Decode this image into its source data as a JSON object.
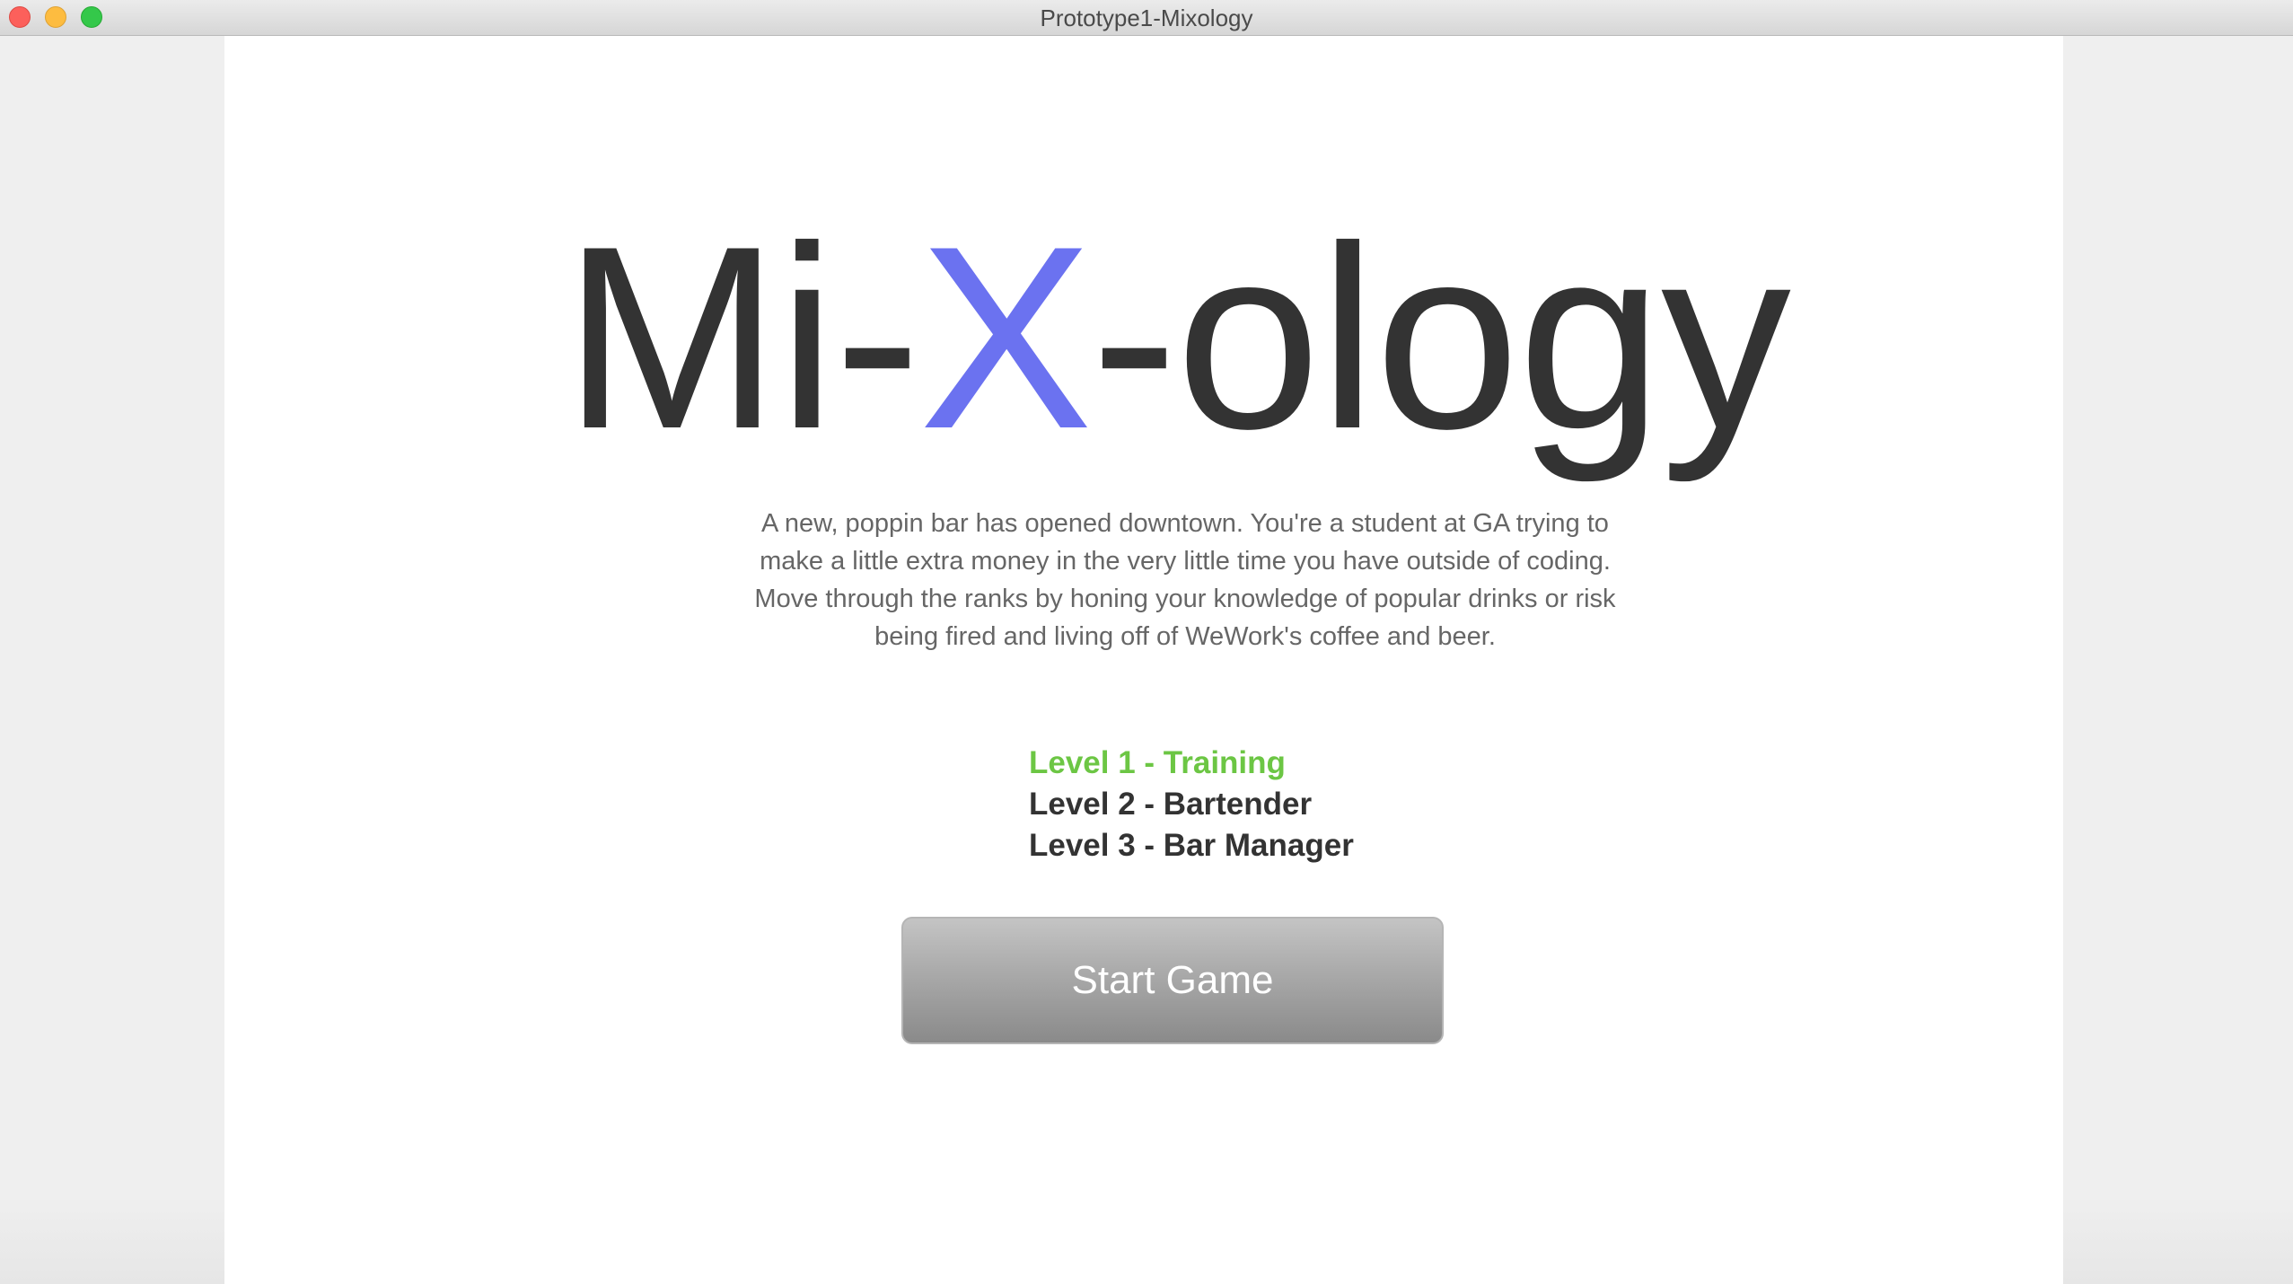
{
  "window": {
    "title": "Prototype1-Mixology"
  },
  "logo": {
    "part1": "Mi-",
    "part2": "X",
    "part3": "-ology",
    "accent_color": "#6b72f0"
  },
  "intro": {
    "lines": [
      "A new, poppin bar has opened downtown. You're a student at GA trying to",
      "make a little extra money in the very little time you have outside of coding.",
      "Move through the ranks by honing your knowledge of popular drinks or risk",
      "being fired and living off of WeWork's coffee and beer."
    ]
  },
  "levels": [
    {
      "label": "Level 1 - Training",
      "active": true
    },
    {
      "label": "Level 2 - Bartender",
      "active": false
    },
    {
      "label": "Level 3 - Bar Manager",
      "active": false
    }
  ],
  "colors": {
    "active_level": "#6cc644",
    "text_dark": "#333333"
  },
  "start_button": {
    "label": "Start Game"
  }
}
